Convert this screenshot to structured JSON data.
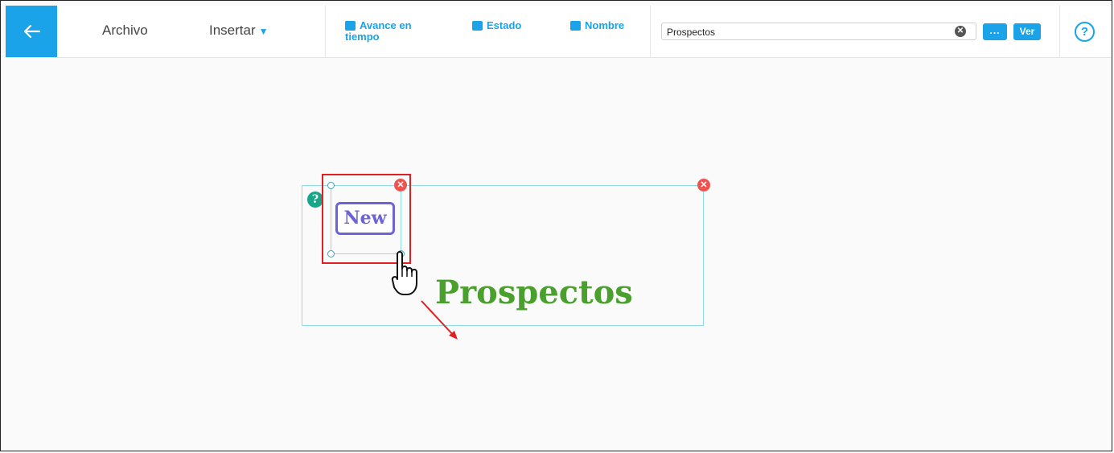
{
  "toolbar": {
    "back_icon": "arrow-left-icon",
    "menu_archivo": "Archivo",
    "menu_insertar": "Insertar",
    "fields": [
      "Avance en tiempo",
      "Estado",
      "Nombre"
    ],
    "search_value": "Prospectos",
    "more_label": "...",
    "ver_label": "Ver",
    "help_label": "?",
    "accent_color": "#1aa3e8"
  },
  "canvas": {
    "help_badge": "?",
    "image_label": "New",
    "title": "Prospectos",
    "title_color": "#4aa02c",
    "highlight_color": "#e02020"
  }
}
